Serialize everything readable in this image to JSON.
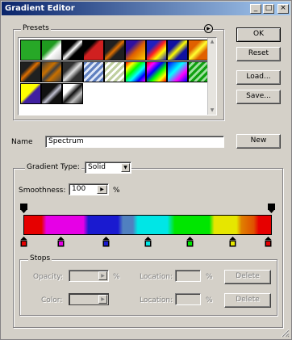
{
  "window": {
    "title": "Gradient Editor",
    "controls": {
      "minimize": "_",
      "maximize": "□",
      "close": "×"
    }
  },
  "presets": {
    "label": "Presets",
    "menu_icon": "play-circle-icon",
    "swatches": [
      {
        "name": "foreground-to-background",
        "css": "linear-gradient(135deg,#27a827 0%,#27a827 100%)"
      },
      {
        "name": "foreground-to-transparent",
        "css": "linear-gradient(135deg,#1f9a1f 0%,#1f9a1f 40%,#ffffff 60%,#c8c8c8 100%)"
      },
      {
        "name": "black-white",
        "css": "linear-gradient(135deg,#000 0%,#000 35%,#fff 50%,#000 65%,#000 100%)"
      },
      {
        "name": "red-black",
        "css": "linear-gradient(135deg,#000 0%,#000 30%,#d02020 45%,#d02020 100%)"
      },
      {
        "name": "orange-black",
        "css": "linear-gradient(135deg,#202020 0%,#202020 35%,#e07000 50%,#202020 65%,#202020 100%)"
      },
      {
        "name": "violet-orange",
        "css": "linear-gradient(135deg,#3010a0 0%,#3010a0 30%,#e06000 55%,#ffd000 100%)"
      },
      {
        "name": "blue-red-yellow",
        "css": "linear-gradient(135deg,#2020c0 0%,#2020c0 30%,#ff2020 50%,#ffff00 70%,#2020c0 100%)"
      },
      {
        "name": "blue-yellow-blue",
        "css": "linear-gradient(135deg,#1010a0 0%,#1010a0 30%,#ffff00 50%,#1010a0 70%,#1010a0 100%)"
      },
      {
        "name": "orange-yellow-orange",
        "css": "linear-gradient(135deg,#e06000 0%,#e06000 30%,#ffff30 50%,#e06000 70%,#e06000 100%)"
      },
      {
        "name": "copper",
        "css": "linear-gradient(135deg,#202020 0%,#202020 30%,#e07000 45%,#202020 60%,#202020 100%)"
      },
      {
        "name": "chrome",
        "css": "linear-gradient(135deg,#404040 0%,#c87000 35%,#404040 50%,#c87000 65%,#404040 100%)"
      },
      {
        "name": "silver",
        "css": "linear-gradient(135deg,#303030 0%,#303030 30%,#e0e0e0 50%,#303030 70%,#303030 100%)"
      },
      {
        "name": "transparent-stripes",
        "css": "repeating-linear-gradient(135deg,#6080c0 0 3px,#e0e8f8 3px 6px)"
      },
      {
        "name": "violet-green",
        "css": "repeating-linear-gradient(135deg,#c0d0a0 0 3px,#ffffff 3px 6px)"
      },
      {
        "name": "spectrum",
        "css": "linear-gradient(135deg,#ff0000,#ffff00,#00ff00,#00ffff,#0000ff,#ff00ff)"
      },
      {
        "name": "transparent-rainbow",
        "css": "linear-gradient(135deg,#ff0000 0%,#ff00ff 20%,#0000ff 40%,#00ff00 60%,#ffff00 80%,#ff0000 100%)"
      },
      {
        "name": "blue-cyan-magenta",
        "css": "linear-gradient(135deg,#0000ff 0%,#00ffff 40%,#ff00ff 70%,#0000ff 100%)"
      },
      {
        "name": "green-stripes",
        "css": "repeating-linear-gradient(135deg,#10a010 0 3px,#a0e0a0 3px 6px)"
      },
      {
        "name": "yellow-violet",
        "css": "linear-gradient(135deg,#ffff00 0%,#ffff00 45%,#4020a0 55%,#4020a0 100%)"
      },
      {
        "name": "dark-silver",
        "css": "linear-gradient(135deg,#101010 0%,#101010 40%,#c0c0d0 55%,#101010 70%,#101010 100%)"
      },
      {
        "name": "gray-silver",
        "css": "linear-gradient(135deg,#ffffff 0%,#ffffff 30%,#101010 50%,#c0c0c0 70%,#101010 100%)"
      }
    ]
  },
  "buttons": {
    "ok": "OK",
    "reset": "Reset",
    "load": "Load...",
    "save": "Save...",
    "new": "New"
  },
  "name_field": {
    "label": "Name",
    "value": "Spectrum"
  },
  "gradient": {
    "group_label": "",
    "type_label": "Gradient Type:",
    "type_value": "Solid",
    "smoothness_label": "Smoothness:",
    "smoothness_value": "100",
    "smoothness_unit": "%"
  },
  "stops": {
    "label": "Stops",
    "opacity_label": "Opacity:",
    "opacity_value": "",
    "opacity_unit": "%",
    "location_label": "Location:",
    "location_value": "",
    "location_unit": "%",
    "color_label": "Color:",
    "location2_label": "Location:",
    "location2_value": "",
    "location2_unit": "%",
    "delete_label": "Delete",
    "delete2_label": "Delete"
  },
  "color_stops": [
    {
      "color": "#e60000",
      "location": 0
    },
    {
      "color": "#e600e6",
      "location": 15
    },
    {
      "color": "#1a1ad0",
      "location": 33
    },
    {
      "color": "#00e6e6",
      "location": 50
    },
    {
      "color": "#00e600",
      "location": 67
    },
    {
      "color": "#e6e600",
      "location": 84
    },
    {
      "color": "#e60000",
      "location": 100
    }
  ],
  "opacity_stops": [
    0,
    100
  ],
  "colors": {
    "dialog_bg": "#d4d0c8",
    "title_bar_start": "#0a246a",
    "title_bar_end": "#a6caf0"
  }
}
